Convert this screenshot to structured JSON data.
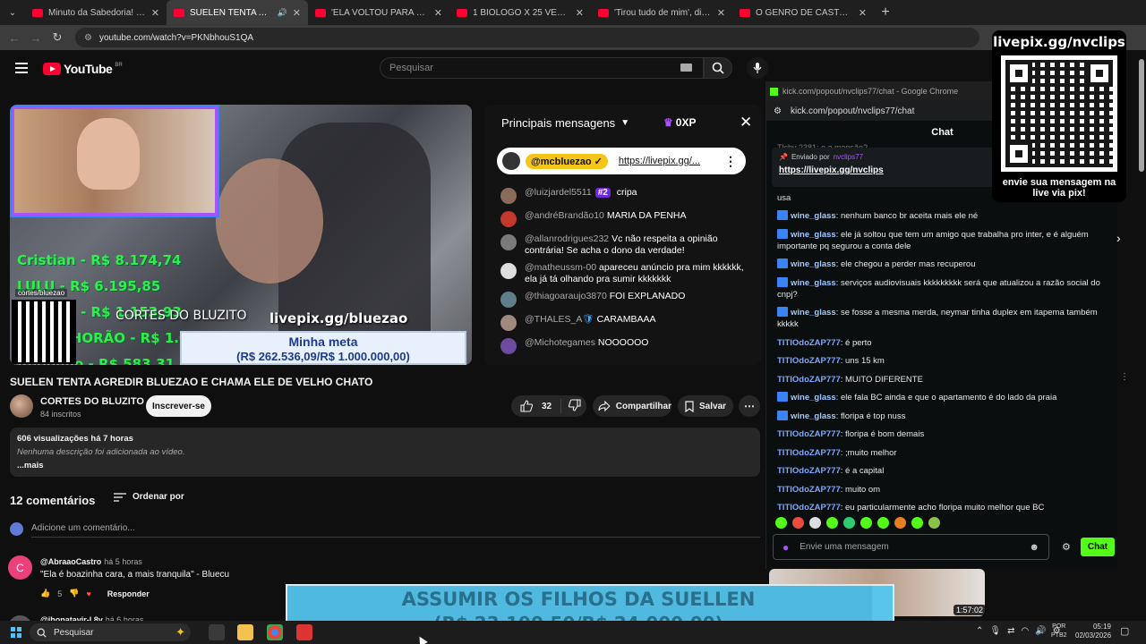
{
  "browser": {
    "tabs": [
      {
        "title": "Minuto da Sabedoria! - YouTube",
        "active": false
      },
      {
        "title": "SUELEN TENTA AGREDIR BLUEZAO",
        "active": true
      },
      {
        "title": "'ELA VOLTOU PARA O MEIO DO",
        "active": false
      },
      {
        "title": "1 BIÓLOGO X 25 VEGANOS | FT",
        "active": false
      },
      {
        "title": "'Tirou tudo de mim', diz vítima",
        "active": false
      },
      {
        "title": "O GENRO DE CASTOR DE ANDRÉ",
        "active": false
      }
    ],
    "url": "youtube.com/watch?v=PKNbhouS1QA"
  },
  "youtube": {
    "logo": "YouTube",
    "country": "BR",
    "search_placeholder": "Pesquisar"
  },
  "video_overlay": {
    "donors": [
      "Cristian - R$ 8.174,74",
      "LULU - R$ 6.195,85",
      "IDOROS - R$ 1.153,93",
      "ZÉ SACHORÃO - R$ 1.083,00",
      "Anônimo - R$ 583,31"
    ],
    "brand_small": "cortes/bluezao",
    "channel_text": "CORTES DO BLUZITO",
    "livepix": "livepix.gg/bluezao",
    "meta_title": "Minha meta",
    "meta_amount": "(R$ 262.536,09/R$ 1.000.000,00)"
  },
  "live_chat": {
    "header": "Principais mensagens",
    "xp": "0XP",
    "pinned_user": "@mcbluezao ✓",
    "pinned_link": "https://livepix.gg/...",
    "messages": [
      {
        "user": "@luizjardel5511",
        "rank": "#2",
        "text": "cripa",
        "color": "#8a6b5a"
      },
      {
        "user": "@andréBrandão10",
        "text": "MARIA DA PENHA",
        "color": "#c0392b"
      },
      {
        "user": "@allanrodrigues232",
        "text": "Vc não respeita a opinião contrária! Se acha o dono da verdade!",
        "color": "#7a7a7a"
      },
      {
        "user": "@matheussm-00",
        "text": "apareceu anúncio pra mim kkkkkk, ela já tá olhando pra sumir kkkkkkk",
        "color": "#dddddd"
      },
      {
        "user": "@thiagoaraujo3870",
        "text": "FOI EXPLANADO",
        "color": "#607d8b"
      },
      {
        "user": "@THALES_A",
        "badge": "🛡",
        "text": "CARAMBAAA",
        "color": "#a1887f"
      },
      {
        "user": "@Michotegames",
        "text": "NOOOOOO",
        "color": "#6d4c9f"
      }
    ]
  },
  "video": {
    "title": "SUELEN TENTA AGREDIR BLUEZAO E CHAMA ELE DE VELHO CHATO",
    "channel": "CORTES DO BLUZITO",
    "subscribers": "84 inscritos",
    "subscribe_label": "Inscrever-se",
    "likes": "32",
    "share_label": "Compartilhar",
    "save_label": "Salvar",
    "stats": "606 visualizações  há 7 horas",
    "no_description": "Nenhuma descrição foi adicionada ao vídeo.",
    "more": "...mais"
  },
  "comments": {
    "count": "12 comentários",
    "sort_label": "Ordenar por",
    "add_placeholder": "Adicione um comentário...",
    "items": [
      {
        "initial": "C",
        "user": "@AbraaoCastro",
        "time": "há 5 horas",
        "text": "\"Ela é boazinha cara, a mais tranquila\" - Bluecu",
        "likes": "5",
        "reply": "Responder"
      },
      {
        "user": "@jhonatavir-l 8v",
        "time": "há 6 horas"
      }
    ]
  },
  "kick": {
    "window_title": "kick.com/popout/nvclips77/chat - Google Chrome",
    "url": "kick.com/popout/nvclips77/chat",
    "chat_label": "Chat",
    "faded_line": "Tlchy 2381: e a mansão?",
    "pinned_by_label": "Enviado por",
    "pinned_by_user": "nvclips77",
    "pinned_link": "https://livepix.gg/nvclips",
    "usa_line": "usa",
    "messages": [
      {
        "user": "wine_glass",
        "kind": "wine",
        "text": "nenhum banco br aceita mais ele né"
      },
      {
        "user": "wine_glass",
        "kind": "wine",
        "text": "ele já soltou que tem um amigo que trabalha pro inter, e é alguém importante pq segurou a conta dele"
      },
      {
        "user": "wine_glass",
        "kind": "wine",
        "text": "ele chegou a perder mas recuperou"
      },
      {
        "user": "wine_glass",
        "kind": "wine",
        "text": "serviços audiovisuais kkkkkkkkk será que atualizou a razão social do cnpj?"
      },
      {
        "user": "wine_glass",
        "kind": "wine",
        "text": "se fosse a mesma merda, neymar tinha duplex em itapema também kkkkk"
      },
      {
        "user": "TITIOdoZAP777",
        "kind": "titi",
        "text": "é perto"
      },
      {
        "user": "TITIOdoZAP777",
        "kind": "titi",
        "text": "uns 15 km"
      },
      {
        "user": "TITIOdoZAP777",
        "kind": "titi",
        "text": "MUITO DIFERENTE"
      },
      {
        "user": "wine_glass",
        "kind": "wine",
        "text": "ele fala BC ainda e que o apartamento é do lado da praia"
      },
      {
        "user": "wine_glass",
        "kind": "wine",
        "text": "floripa é top nuss"
      },
      {
        "user": "TITIOdoZAP777",
        "kind": "titi",
        "text": "floripa é bom demais"
      },
      {
        "user": "TITIOdoZAP777",
        "kind": "titi",
        "text": ";muito melhor"
      },
      {
        "user": "TITIOdoZAP777",
        "kind": "titi",
        "text": "é a capital"
      },
      {
        "user": "TITIOdoZAP777",
        "kind": "titi",
        "text": "muito om"
      },
      {
        "user": "TITIOdoZAP777",
        "kind": "titi",
        "text": "eu particularmente acho floripa muito melhor que BC"
      }
    ],
    "input_placeholder": "Envie uma mensagem",
    "send_label": "Chat"
  },
  "qr_overlay": {
    "title": "livepix.gg/nvclips",
    "footer_1": "envie sua mensagem na",
    "footer_2": "live via pix!"
  },
  "side": {
    "duration": "1:57:02"
  },
  "banner": {
    "line1": "ASSUMIR OS FILHOS DA SUELLEN",
    "line2": "(R$ 23.190,50/R$ 24.000,00)",
    "progress": 0.9663
  },
  "taskbar": {
    "search_label": "Pesquisar",
    "lang_1": "POR",
    "lang_2": "PTB2",
    "time": "05:19",
    "date": "02/03/2026"
  }
}
